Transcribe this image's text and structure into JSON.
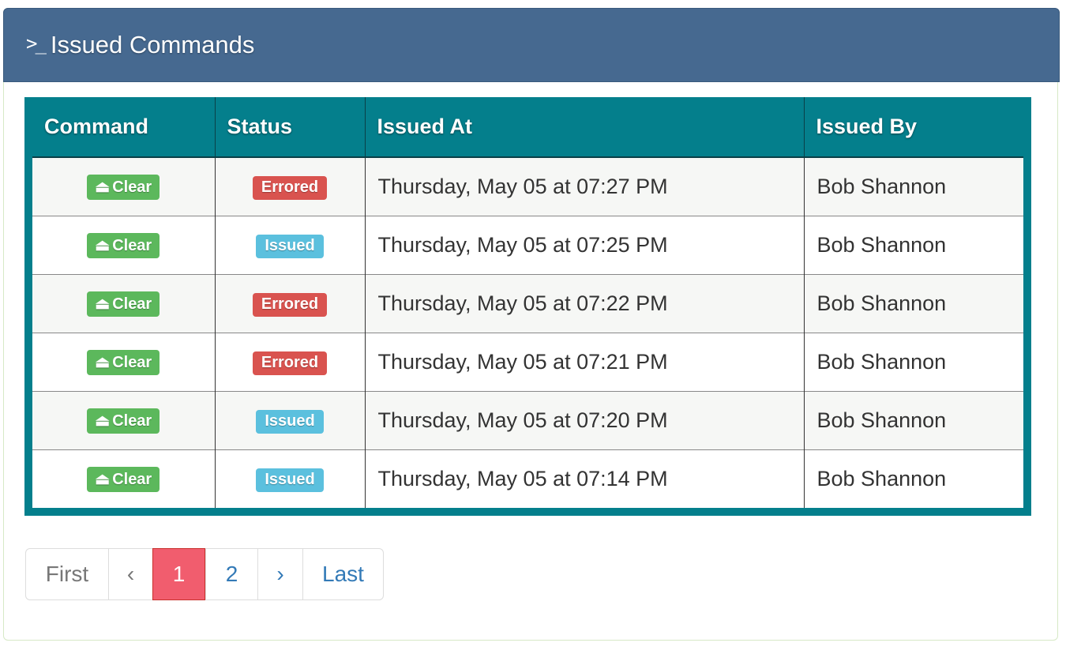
{
  "panel": {
    "icon": ">_",
    "title": "Issued Commands"
  },
  "table": {
    "headers": [
      "Command",
      "Status",
      "Issued At",
      "Issued By"
    ],
    "rows": [
      {
        "command": "Clear",
        "status": "Errored",
        "issued_at": "Thursday, May 05 at 07:27 PM",
        "issued_by": "Bob Shannon"
      },
      {
        "command": "Clear",
        "status": "Issued",
        "issued_at": "Thursday, May 05 at 07:25 PM",
        "issued_by": "Bob Shannon"
      },
      {
        "command": "Clear",
        "status": "Errored",
        "issued_at": "Thursday, May 05 at 07:22 PM",
        "issued_by": "Bob Shannon"
      },
      {
        "command": "Clear",
        "status": "Errored",
        "issued_at": "Thursday, May 05 at 07:21 PM",
        "issued_by": "Bob Shannon"
      },
      {
        "command": "Clear",
        "status": "Issued",
        "issued_at": "Thursday, May 05 at 07:20 PM",
        "issued_by": "Bob Shannon"
      },
      {
        "command": "Clear",
        "status": "Issued",
        "issued_at": "Thursday, May 05 at 07:14 PM",
        "issued_by": "Bob Shannon"
      }
    ],
    "command_icon": "eject-icon"
  },
  "pagination": {
    "first": "First",
    "prev": "‹",
    "pages": [
      "1",
      "2"
    ],
    "current": "1",
    "next": "›",
    "last": "Last"
  },
  "colors": {
    "heading": "#466990",
    "table_frame": "#047f8c",
    "clear_button": "#5cb85c",
    "errored": "#d9534f",
    "issued": "#5bc0de",
    "active_page": "#f15d6e"
  }
}
